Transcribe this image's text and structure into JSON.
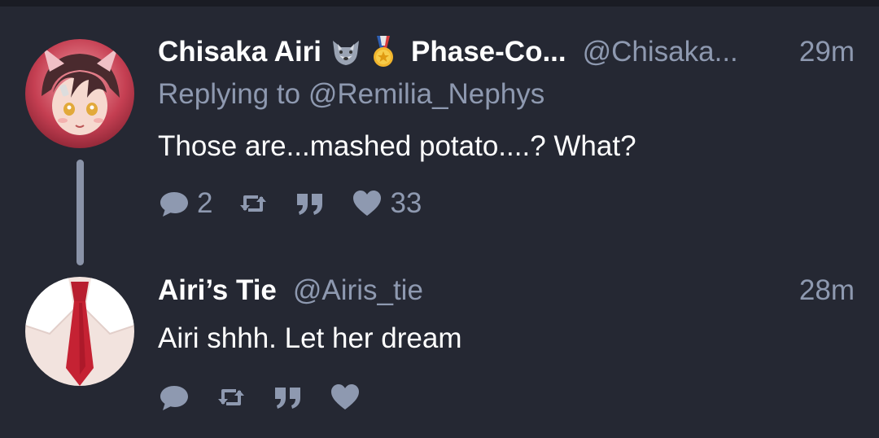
{
  "colors": {
    "background": "#252833",
    "text_primary": "#ffffff",
    "text_secondary": "#8e99b0",
    "thread_line": "#8a93a8"
  },
  "posts": [
    {
      "display_name": "Chisaka Airi",
      "badges": [
        "wolf-emoji-icon",
        "medal-emoji-icon"
      ],
      "secondary_name": "Phase-Co...",
      "handle": "@Chisaka...",
      "time": "29m",
      "reply_prefix": "Replying to",
      "reply_handle": "@Remilia_Nephys",
      "text": "Those are...mashed potato....? What?",
      "actions": {
        "reply_count": "2",
        "retweet_count": "",
        "quote_count": "",
        "like_count": "33"
      }
    },
    {
      "display_name": "Airi’s Tie",
      "handle": "@Airis_tie",
      "time": "28m",
      "text": "Airi shhh. Let her dream",
      "actions": {
        "reply_count": "",
        "retweet_count": "",
        "quote_count": "",
        "like_count": ""
      }
    }
  ]
}
